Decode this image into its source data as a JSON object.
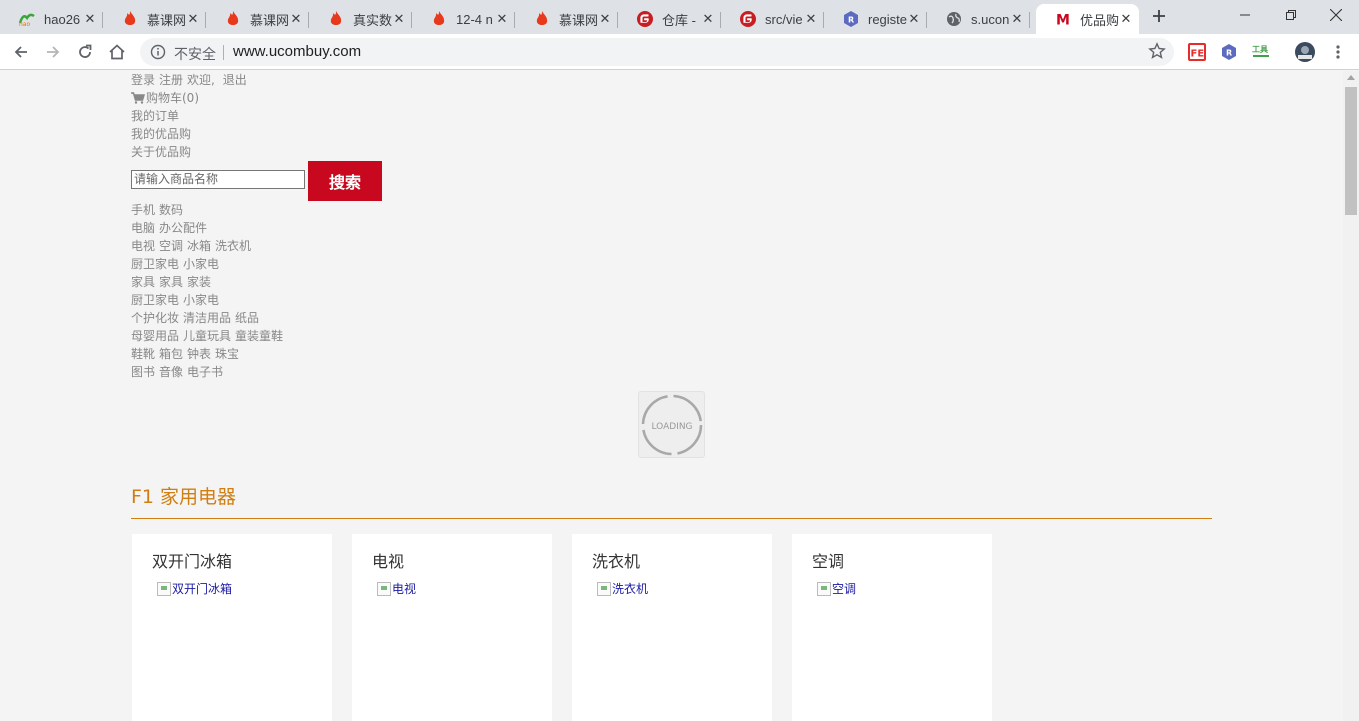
{
  "tabs": [
    {
      "title": "hao26",
      "icon": "hao123-icon"
    },
    {
      "title": "慕课网",
      "icon": "flame-icon"
    },
    {
      "title": "慕课网",
      "icon": "flame-icon"
    },
    {
      "title": "真实数",
      "icon": "flame-icon"
    },
    {
      "title": "12-4 n",
      "icon": "flame-icon"
    },
    {
      "title": "慕课网",
      "icon": "flame-icon"
    },
    {
      "title": "仓库 -",
      "icon": "gitee-icon"
    },
    {
      "title": "src/vie",
      "icon": "gitee-icon"
    },
    {
      "title": "registe",
      "icon": "r-icon"
    },
    {
      "title": "s.ucon",
      "icon": "globe-icon"
    },
    {
      "title": "优品购",
      "icon": "m-icon"
    }
  ],
  "toolbar": {
    "insecure_label": "不安全",
    "url": "www.ucombuy.com"
  },
  "header": {
    "login": "登录",
    "register": "注册",
    "welcome": "欢迎,",
    "logout": "退出",
    "cart": "购物车(0)",
    "orders": "我的订单",
    "my_shop": "我的优品购",
    "about": "关于优品购"
  },
  "search": {
    "placeholder": "请输入商品名称",
    "button": "搜索"
  },
  "categories": [
    [
      "手机",
      "数码"
    ],
    [
      "电脑",
      "办公配件"
    ],
    [
      "电视",
      "空调",
      "冰箱",
      "洗衣机"
    ],
    [
      "厨卫家电",
      "小家电"
    ],
    [
      "家具",
      "家具",
      "家装"
    ],
    [
      "厨卫家电",
      "小家电"
    ],
    [
      "个护化妆",
      "清洁用品",
      "纸品"
    ],
    [
      "母婴用品",
      "儿童玩具",
      "童装童鞋"
    ],
    [
      "鞋靴",
      "箱包",
      "钟表",
      "珠宝"
    ],
    [
      "图书",
      "音像",
      "电子书"
    ]
  ],
  "loading_text": "LOADING",
  "floor": {
    "title": "F1 家用电器",
    "products": [
      {
        "name": "双开门冰箱",
        "alt": "双开门冰箱"
      },
      {
        "name": "电视",
        "alt": "电视"
      },
      {
        "name": "洗衣机",
        "alt": "洗衣机"
      },
      {
        "name": "空调",
        "alt": "空调"
      }
    ]
  },
  "colors": {
    "accent": "#c8081f",
    "floor": "#d07e12",
    "link": "#888888"
  }
}
